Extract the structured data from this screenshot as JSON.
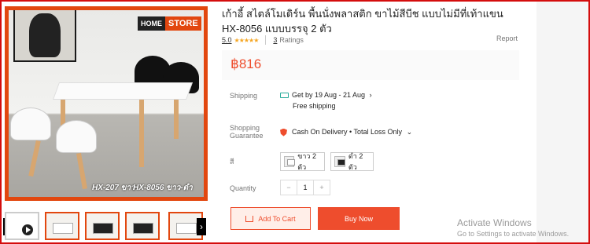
{
  "brand_badge": {
    "home": "HOME",
    "store": "STORE"
  },
  "image_captions": {
    "left": "HX-207 ขาว",
    "right": "HX-8056 ขาว-ดำ"
  },
  "product": {
    "title": "เก้าอี้ สไตล์โมเดิร์น พื้นนั่งพลาสติก ขาไม้สีบีช แบบไม่มีที่เท้าแขน HX-8056 แบบบรรจุ 2 ตัว",
    "rating_score": "5.0",
    "stars": "★★★★★",
    "rating_count": "3",
    "rating_label": "Ratings",
    "report_label": "Report",
    "price": "฿816"
  },
  "shipping": {
    "label": "Shipping",
    "date": "Get by 19 Aug - 21 Aug",
    "chevron": "›",
    "free": "Free shipping"
  },
  "guarantee": {
    "label_line1": "Shopping",
    "label_line2": "Guarantee",
    "text": "Cash On Delivery • Total Loss Only",
    "chevron": "⌄"
  },
  "color": {
    "label": "สี",
    "options": [
      "ขาว 2 ตัว",
      "ดำ 2 ตัว"
    ]
  },
  "quantity": {
    "label": "Quantity",
    "minus": "−",
    "value": "1",
    "plus": "+"
  },
  "buttons": {
    "add_to_cart": "Add To Cart",
    "buy_now": "Buy Now"
  },
  "thumb_nav": {
    "prev": "‹",
    "next": "›"
  },
  "watermark": {
    "line1": "Activate Windows",
    "line2": "Go to Settings to activate Windows."
  },
  "colors": {
    "accent": "#ee4d2d",
    "frame": "#d40d0d",
    "star": "#f5a623",
    "shipping_icon": "#26aa99"
  }
}
